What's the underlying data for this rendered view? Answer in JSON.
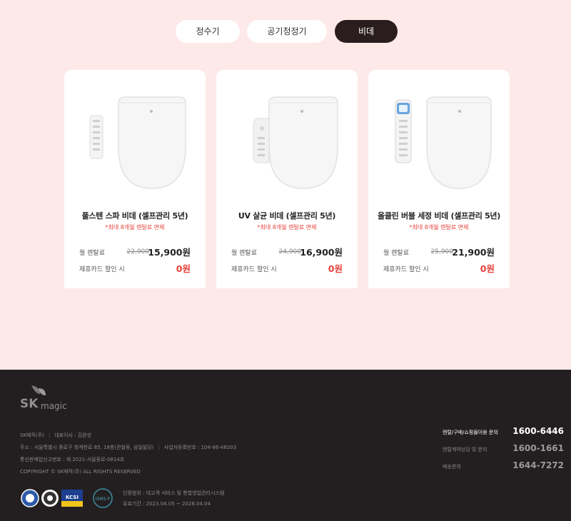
{
  "tabs": [
    {
      "label": "정수기",
      "active": false
    },
    {
      "label": "공기청정기",
      "active": false
    },
    {
      "label": "비데",
      "active": true
    }
  ],
  "products": [
    {
      "name": "풀스텐 스파 비데 (셀프관리 5년)",
      "promo": "*최대 8개월 렌탈료 면제",
      "monthly_label": "월 렌탈료",
      "original_price": "22,900",
      "price": "15,900원",
      "card_label": "제휴카드 할인 시",
      "card_price": "0원"
    },
    {
      "name": "UV 살균 비데 (셀프관리 5년)",
      "promo": "*최대 8개월 렌탈료 면제",
      "monthly_label": "월 렌탈료",
      "original_price": "24,900",
      "price": "16,900원",
      "card_label": "제휴카드 할인 시",
      "card_price": "0원"
    },
    {
      "name": "올클린 버블 세정 비데 (셀프관리 5년)",
      "promo": "*최대 8개월 렌탈료 면제",
      "monthly_label": "월 렌탈료",
      "original_price": "25,900",
      "price": "21,900원",
      "card_label": "제휴카드 할인 시",
      "card_price": "0원"
    }
  ],
  "footer": {
    "logo_sk": "SK",
    "logo_magic": "magic",
    "company": "SK매직(주)",
    "ceo": "대표이사 : 김완성",
    "address": "주소 : 서울특별시 종로구 청계천로 85, 18층(관철동, 삼일빌딩)",
    "biz_no": "사업자등록번호 : 104-86-48203",
    "ecommerce": "통신판매업신고번호 : 제 2021-서울종로-0814호",
    "copyright": "COPYRIGHT © SK매직(주) ALL RIGHTS RESERVED",
    "badges": [
      "ISO",
      "KCP",
      "KCSI",
      "ISMS-P"
    ],
    "cert_scope": "인증범위 : 대고객 서비스 및 통합영업관리시스템",
    "cert_period": "유효기간 : 2023.04.05 ~ 2026.04.04",
    "contacts": [
      {
        "label": "렌탈/구매/쇼핑몰이용 문의",
        "number": "1600-6446"
      },
      {
        "label": "렌탈계약상담 및 문의",
        "number": "1600-1661"
      },
      {
        "label": "배송문의",
        "number": "1644-7272"
      }
    ]
  },
  "colors": {
    "background": "#fde9e8",
    "active_tab": "#2a1d1e",
    "accent_red": "#e8403a",
    "footer_bg": "#231f20"
  }
}
